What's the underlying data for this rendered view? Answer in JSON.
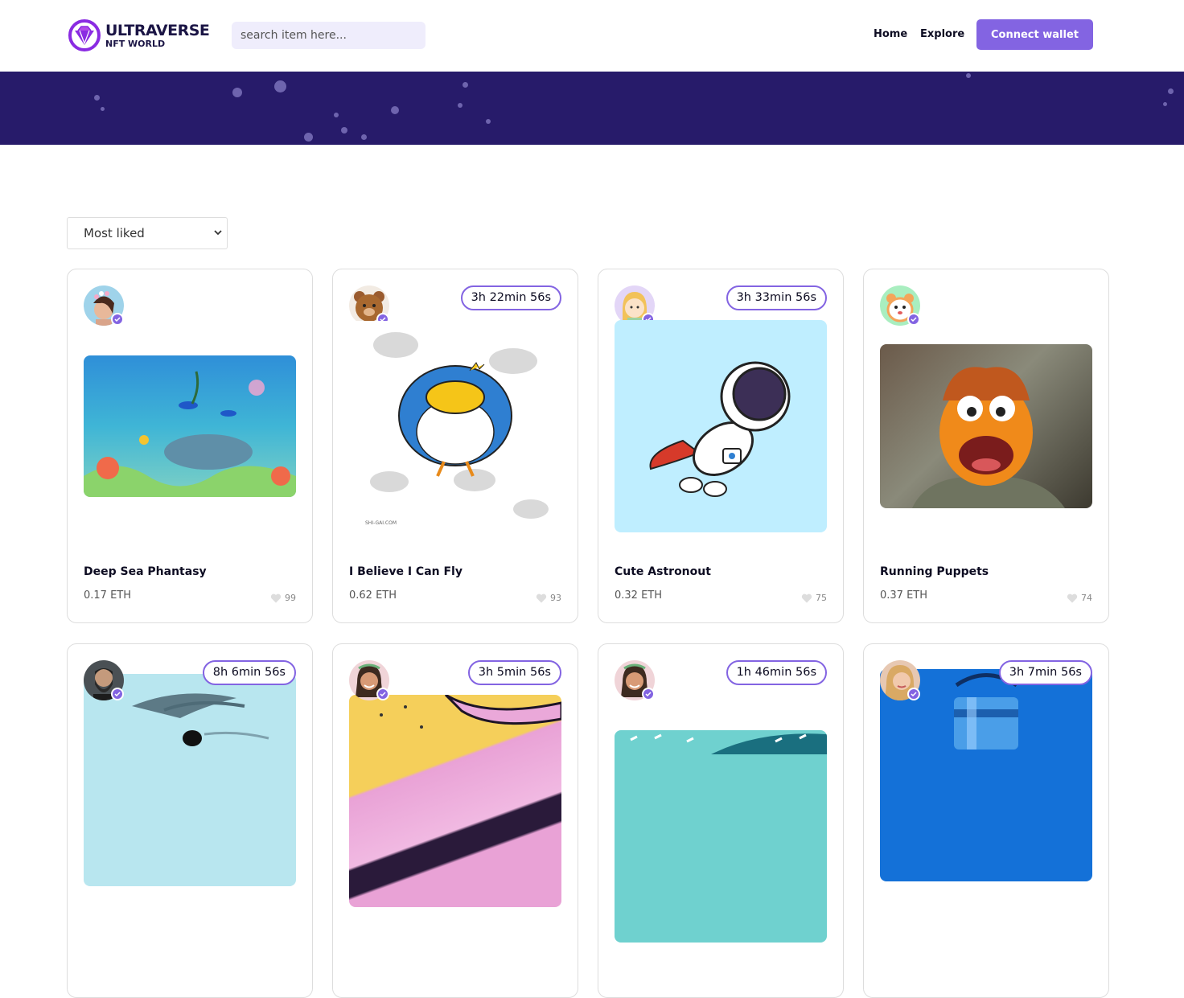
{
  "header": {
    "logo_line1": "ULTRAVERSE",
    "logo_line2": "NFT WORLD",
    "search_placeholder": "search item here...",
    "nav": [
      "Home",
      "Explore"
    ],
    "connect_label": "Connect wallet"
  },
  "filter": {
    "selected": "Most liked"
  },
  "colors": {
    "accent": "#8364e2",
    "banner": "#271b6a",
    "search_bg": "#efedfc"
  },
  "items": [
    {
      "title": "Deep Sea Phantasy",
      "price": "0.17 ETH",
      "likes": "99",
      "timer": "",
      "avatar": "woman-flowers-avatar",
      "image": "underwater-scene-image"
    },
    {
      "title": "I Believe I Can Fly",
      "price": "0.62 ETH",
      "likes": "93",
      "timer": "3h 22min 56s",
      "avatar": "teddy-bear-avatar",
      "image": "flying-penguin-image",
      "image_caption": "SHI-GAI.COM"
    },
    {
      "title": "Cute Astronout",
      "price": "0.32 ETH",
      "likes": "75",
      "timer": "3h 33min 56s",
      "avatar": "girl-cartoon-avatar",
      "image": "astronaut-cartoon-image"
    },
    {
      "title": "Running Puppets",
      "price": "0.37 ETH",
      "likes": "74",
      "timer": "",
      "avatar": "hamster-avatar",
      "image": "puppet-image"
    },
    {
      "title": "",
      "price": "",
      "likes": "",
      "timer": "8h 6min 56s",
      "avatar": "bearded-man-avatar",
      "image": "whale-illustration-image"
    },
    {
      "title": "",
      "price": "",
      "likes": "",
      "timer": "3h 5min 56s",
      "avatar": "smiling-woman-avatar",
      "image": "marble-paint-image"
    },
    {
      "title": "",
      "price": "",
      "likes": "",
      "timer": "1h 46min 56s",
      "avatar": "smiling-woman-avatar",
      "image": "teal-pattern-image"
    },
    {
      "title": "",
      "price": "",
      "likes": "",
      "timer": "3h 7min 56s",
      "avatar": "blonde-woman-avatar",
      "image": "blue-bottle-image"
    }
  ]
}
